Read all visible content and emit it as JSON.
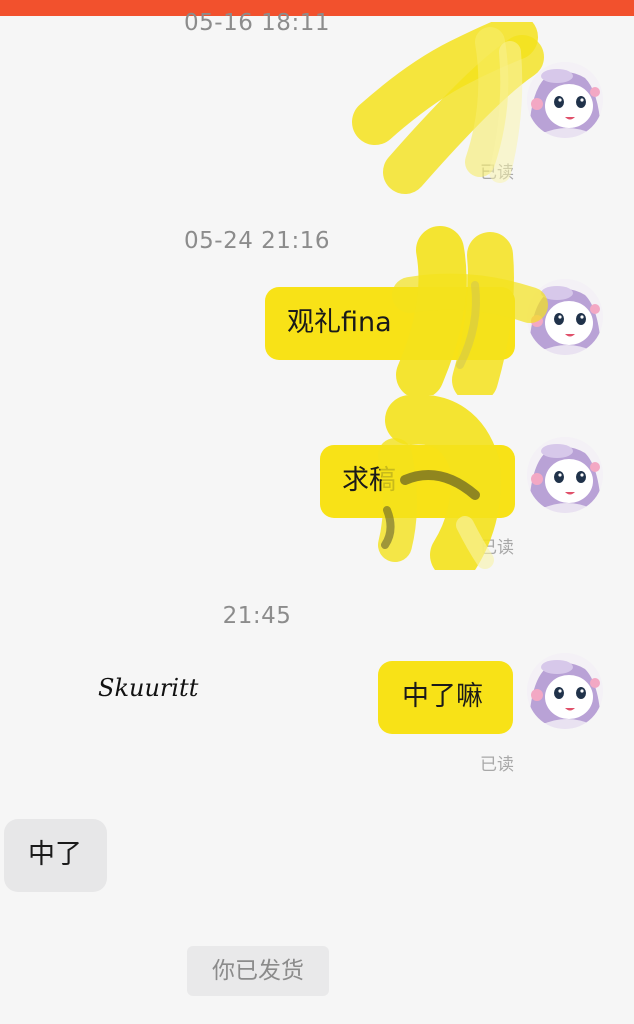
{
  "status_bar": {
    "color": "#f2512d"
  },
  "colors": {
    "sent_bubble": "#f8e217",
    "received_bubble": "#e7e7e8",
    "timestamp_text": "#8c8c8c",
    "scribble_overlay": "#f4e21c"
  },
  "chat": {
    "timestamps": [
      "05-16 18:11",
      "05-24 21:16",
      "21:45"
    ],
    "messages": [
      {
        "side": "sent",
        "text": "观礼fina",
        "read_label": ""
      },
      {
        "side": "sent",
        "text": "求稿",
        "read_label": "已读"
      },
      {
        "side": "sent",
        "text": "中了嘛",
        "read_label": "已读"
      },
      {
        "side": "received",
        "text": "中了",
        "read_label": ""
      }
    ],
    "first_read_label": "已读",
    "system_notice": "你已发货"
  },
  "watermark": {
    "text": "Skuuritt"
  },
  "avatar": {
    "icon": "anime-character-avatar-icon"
  }
}
